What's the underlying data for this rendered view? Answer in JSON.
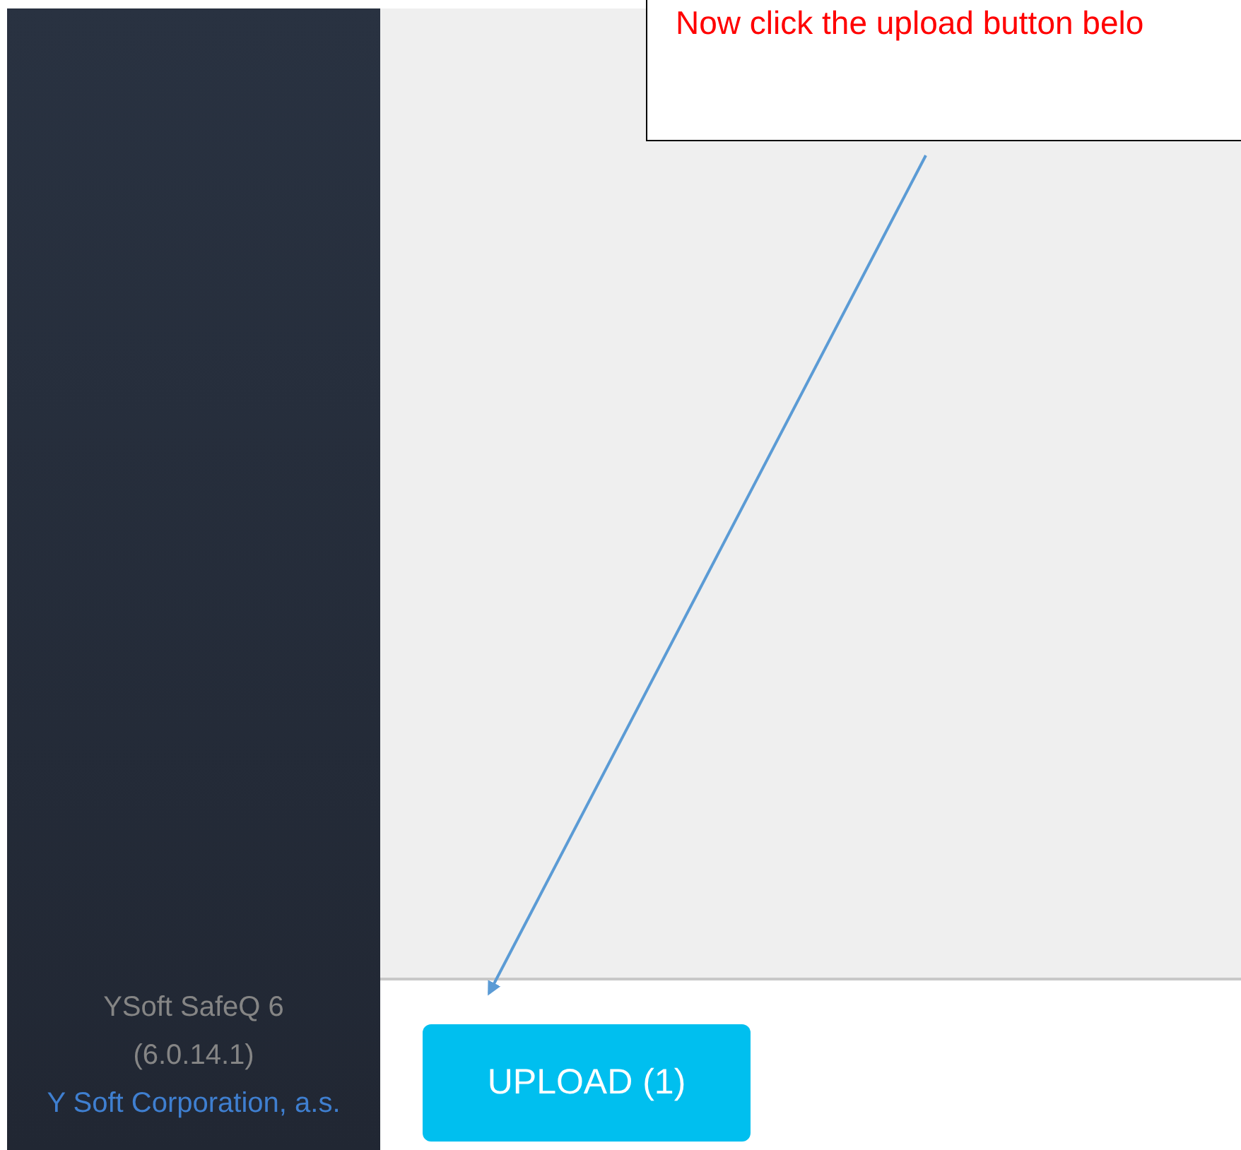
{
  "sidebar": {
    "product": "YSoft SafeQ 6",
    "version": "(6.0.14.1)",
    "company_link": "Y Soft Corporation, a.s."
  },
  "callout": {
    "text": "Now click the upload button belo"
  },
  "upload_button": {
    "label": "UPLOAD (1)"
  }
}
